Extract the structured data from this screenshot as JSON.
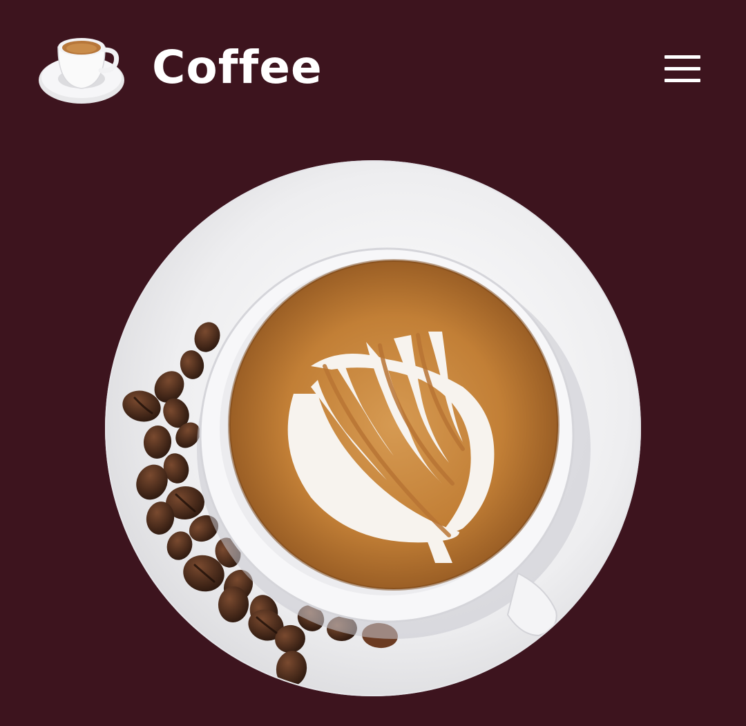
{
  "header": {
    "brand_title": "Coffee",
    "logo_icon": "coffee-cup-logo-icon",
    "menu_icon": "hamburger-menu-icon"
  },
  "hero": {
    "image": "latte-art-coffee-cup-with-beans"
  },
  "colors": {
    "background": "#3d141e",
    "title_text": "#ffffff",
    "saucer": "#f2f2f4",
    "crema": "#c8883b",
    "foam": "#f7f3ee",
    "bean": "#4a2a1b"
  }
}
